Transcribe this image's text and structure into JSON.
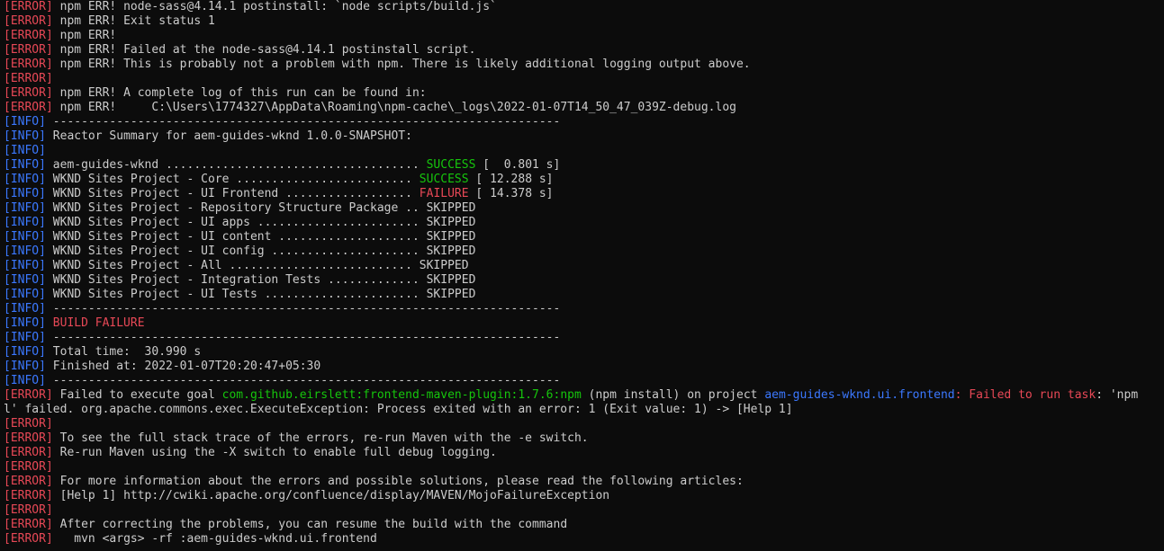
{
  "window": {
    "title": "",
    "background": "#0c0c0c"
  },
  "colors": {
    "error": "#e74856",
    "info": "#3b78ff",
    "success": "#16c60c",
    "text": "#cccccc"
  },
  "lines": [
    [
      [
        "red",
        "[ERROR]"
      ],
      [
        "gray",
        " npm ERR! node-sass@4.14.1 postinstall: `node scripts/build.js`"
      ]
    ],
    [
      [
        "red",
        "[ERROR]"
      ],
      [
        "gray",
        " npm ERR! Exit status 1"
      ]
    ],
    [
      [
        "red",
        "[ERROR]"
      ],
      [
        "gray",
        " npm ERR!"
      ]
    ],
    [
      [
        "red",
        "[ERROR]"
      ],
      [
        "gray",
        " npm ERR! Failed at the node-sass@4.14.1 postinstall script."
      ]
    ],
    [
      [
        "red",
        "[ERROR]"
      ],
      [
        "gray",
        " npm ERR! This is probably not a problem with npm. There is likely additional logging output above."
      ]
    ],
    [
      [
        "red",
        "[ERROR]"
      ]
    ],
    [
      [
        "red",
        "[ERROR]"
      ],
      [
        "gray",
        " npm ERR! A complete log of this run can be found in:"
      ]
    ],
    [
      [
        "red",
        "[ERROR]"
      ],
      [
        "gray",
        " npm ERR!     C:\\Users\\1774327\\AppData\\Roaming\\npm-cache\\_logs\\2022-01-07T14_50_47_039Z-debug.log"
      ]
    ],
    [
      [
        "blue",
        "[INFO]"
      ],
      [
        "gray",
        " ------------------------------------------------------------------------"
      ]
    ],
    [
      [
        "blue",
        "[INFO]"
      ],
      [
        "gray",
        " Reactor Summary for aem-guides-wknd 1.0.0-SNAPSHOT:"
      ]
    ],
    [
      [
        "blue",
        "[INFO]"
      ]
    ],
    [
      [
        "blue",
        "[INFO]"
      ],
      [
        "gray",
        " aem-guides-wknd .................................... "
      ],
      [
        "green",
        "SUCCESS"
      ],
      [
        "gray",
        " [  0.801 s]"
      ]
    ],
    [
      [
        "blue",
        "[INFO]"
      ],
      [
        "gray",
        " WKND Sites Project - Core ......................... "
      ],
      [
        "green",
        "SUCCESS"
      ],
      [
        "gray",
        " [ 12.288 s]"
      ]
    ],
    [
      [
        "blue",
        "[INFO]"
      ],
      [
        "gray",
        " WKND Sites Project - UI Frontend .................. "
      ],
      [
        "red",
        "FAILURE"
      ],
      [
        "gray",
        " [ 14.378 s]"
      ]
    ],
    [
      [
        "blue",
        "[INFO]"
      ],
      [
        "gray",
        " WKND Sites Project - Repository Structure Package .. SKIPPED"
      ]
    ],
    [
      [
        "blue",
        "[INFO]"
      ],
      [
        "gray",
        " WKND Sites Project - UI apps ....................... SKIPPED"
      ]
    ],
    [
      [
        "blue",
        "[INFO]"
      ],
      [
        "gray",
        " WKND Sites Project - UI content .................... SKIPPED"
      ]
    ],
    [
      [
        "blue",
        "[INFO]"
      ],
      [
        "gray",
        " WKND Sites Project - UI config ..................... SKIPPED"
      ]
    ],
    [
      [
        "blue",
        "[INFO]"
      ],
      [
        "gray",
        " WKND Sites Project - All .......................... SKIPPED"
      ]
    ],
    [
      [
        "blue",
        "[INFO]"
      ],
      [
        "gray",
        " WKND Sites Project - Integration Tests ............. SKIPPED"
      ]
    ],
    [
      [
        "blue",
        "[INFO]"
      ],
      [
        "gray",
        " WKND Sites Project - UI Tests ...................... SKIPPED"
      ]
    ],
    [
      [
        "blue",
        "[INFO]"
      ],
      [
        "gray",
        " ------------------------------------------------------------------------"
      ]
    ],
    [
      [
        "blue",
        "[INFO]"
      ],
      [
        "red",
        " BUILD FAILURE"
      ]
    ],
    [
      [
        "blue",
        "[INFO]"
      ],
      [
        "gray",
        " ------------------------------------------------------------------------"
      ]
    ],
    [
      [
        "blue",
        "[INFO]"
      ],
      [
        "gray",
        " Total time:  30.990 s"
      ]
    ],
    [
      [
        "blue",
        "[INFO]"
      ],
      [
        "gray",
        " Finished at: 2022-01-07T20:20:47+05:30"
      ]
    ],
    [
      [
        "blue",
        "[INFO]"
      ],
      [
        "gray",
        " ------------------------------------------------------------------------"
      ]
    ],
    [
      [
        "red",
        "[ERROR]"
      ],
      [
        "gray",
        " Failed to execute goal "
      ],
      [
        "green",
        "com.github.eirslett:frontend-maven-plugin:1.7.6:npm"
      ],
      [
        "gray",
        " (npm install) on project "
      ],
      [
        "blue",
        "aem-guides-wknd.ui.frontend"
      ],
      [
        "red",
        ": Failed to run task"
      ],
      [
        "gray",
        ": 'npm"
      ]
    ],
    [
      [
        "gray",
        "l' failed. org.apache.commons.exec.ExecuteException: Process exited with an error: 1 (Exit value: 1) -> [Help 1]"
      ]
    ],
    [
      [
        "red",
        "[ERROR]"
      ]
    ],
    [
      [
        "red",
        "[ERROR]"
      ],
      [
        "gray",
        " To see the full stack trace of the errors, re-run Maven with the -e switch."
      ]
    ],
    [
      [
        "red",
        "[ERROR]"
      ],
      [
        "gray",
        " Re-run Maven using the -X switch to enable full debug logging."
      ]
    ],
    [
      [
        "red",
        "[ERROR]"
      ]
    ],
    [
      [
        "red",
        "[ERROR]"
      ],
      [
        "gray",
        " For more information about the errors and possible solutions, please read the following articles:"
      ]
    ],
    [
      [
        "red",
        "[ERROR]"
      ],
      [
        "gray",
        " [Help 1] http://cwiki.apache.org/confluence/display/MAVEN/MojoFailureException"
      ]
    ],
    [
      [
        "red",
        "[ERROR]"
      ]
    ],
    [
      [
        "red",
        "[ERROR]"
      ],
      [
        "gray",
        " After correcting the problems, you can resume the build with the command"
      ]
    ],
    [
      [
        "red",
        "[ERROR]"
      ],
      [
        "gray",
        "   mvn <args> -rf :aem-guides-wknd.ui.frontend"
      ]
    ]
  ]
}
